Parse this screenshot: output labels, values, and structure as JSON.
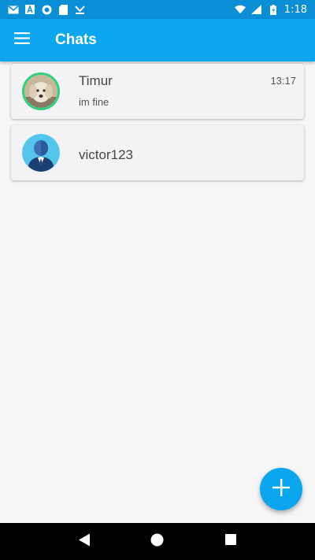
{
  "status_bar": {
    "time": "1:18",
    "left_icons": [
      "gmail-icon",
      "font-icon",
      "circle-app-icon",
      "sd-card-icon",
      "download-icon"
    ],
    "right_icons": [
      "wifi-icon",
      "signal-icon",
      "battery-icon"
    ]
  },
  "app_bar": {
    "title": "Chats",
    "background": "#0ba6ee"
  },
  "chats": [
    {
      "name": "Timur",
      "message": "im fine",
      "time": "13:17",
      "avatar": "dog-photo-avatar"
    },
    {
      "name": "victor123",
      "message": "",
      "time": "",
      "avatar": "default-user-avatar"
    }
  ],
  "fab": {
    "icon": "plus-icon",
    "color": "#0ba6ee"
  },
  "nav_bar": {
    "buttons": [
      "back-icon",
      "home-icon",
      "recents-icon"
    ]
  }
}
